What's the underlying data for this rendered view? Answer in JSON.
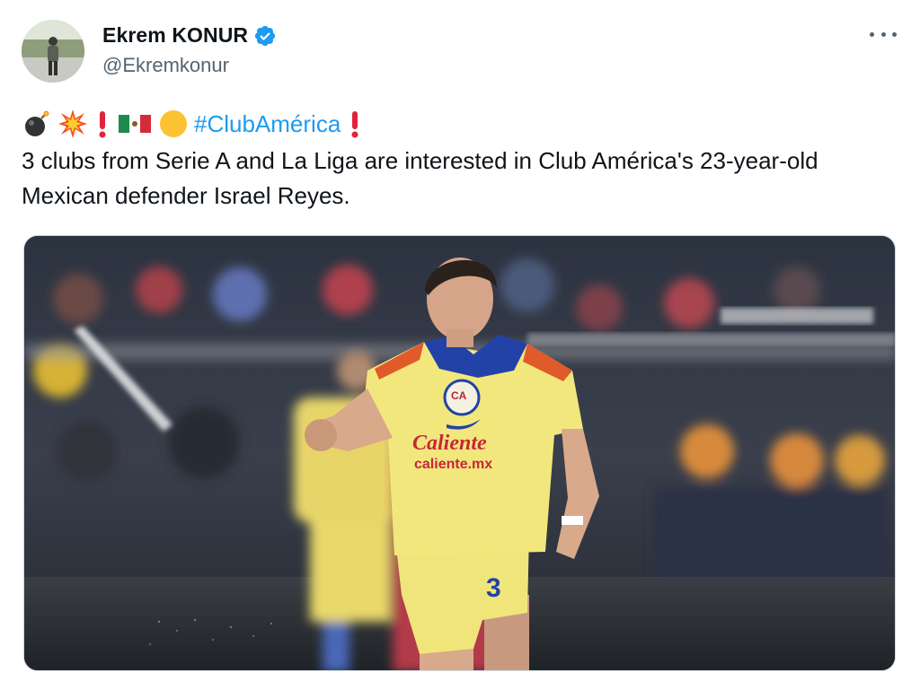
{
  "author": {
    "display_name": "Ekrem KONUR",
    "handle": "@Ekremkonur",
    "verified": true,
    "verified_color": "#1d9bf0"
  },
  "tweet": {
    "emojis_before": [
      "bomb-icon",
      "collision-icon",
      "exclamation-icon",
      "mexico-flag-icon",
      "yellow-circle-icon"
    ],
    "hashtag": "#ClubAmérica",
    "emojis_after": [
      "exclamation-icon"
    ],
    "text": "3 clubs from Serie A and La Liga are interested in Club América's 23-year-old Mexican defender Israel Reyes.",
    "link_color": "#1d9bf0"
  },
  "media": {
    "jersey_sponsor": "Caliente",
    "jersey_sponsor_url": "caliente.mx",
    "shirt_number": "3",
    "crest_text": "CA"
  }
}
